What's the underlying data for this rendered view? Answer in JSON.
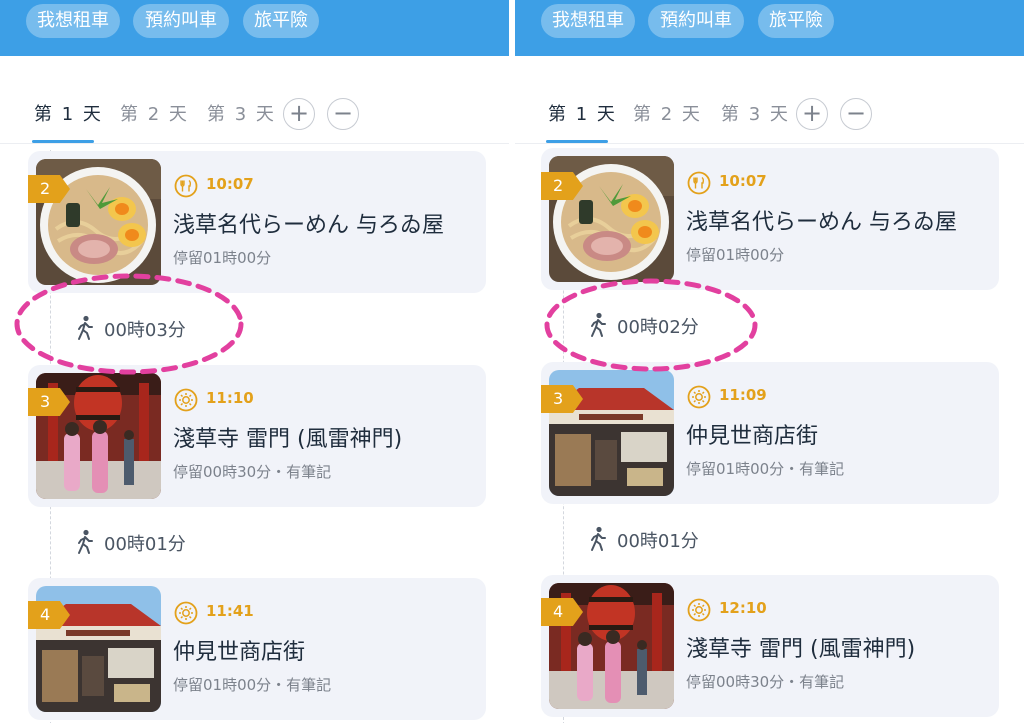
{
  "colors": {
    "header": "#3d9fe6",
    "accent": "#3d9fe6",
    "badge": "#e3a11b",
    "time": "#e3a11b",
    "highlight": "#e2409f",
    "card": "#f1f3f9"
  },
  "panels": [
    {
      "header_buttons": [
        "我想租車",
        "預約叫車",
        "旅平險"
      ],
      "tabs": [
        "第 1 天",
        "第 2 天",
        "第 3 天"
      ],
      "add_icon": "plus-icon",
      "remove_icon": "minus-icon",
      "stops": [
        {
          "number": "2",
          "category_icon": "restaurant-icon",
          "time": "10:07",
          "title": "浅草名代らーめん 与ろゐ屋",
          "stay": "停留01時00分",
          "thumbnail": "ramen-photo"
        },
        {
          "number": "3",
          "category_icon": "sightseeing-icon",
          "time": "11:10",
          "title": "淺草寺 雷門 (風雷神門)",
          "stay": "停留00時30分・有筆記",
          "thumbnail": "kaminarimon-photo"
        },
        {
          "number": "4",
          "category_icon": "sightseeing-icon",
          "time": "11:41",
          "title": "仲見世商店街",
          "stay": "停留01時00分・有筆記",
          "thumbnail": "nakamise-photo"
        }
      ],
      "walks": [
        {
          "icon": "walking-person-icon",
          "duration": "00時03分"
        },
        {
          "icon": "walking-person-icon",
          "duration": "00時01分"
        }
      ]
    },
    {
      "header_buttons": [
        "我想租車",
        "預約叫車",
        "旅平險"
      ],
      "tabs": [
        "第 1 天",
        "第 2 天",
        "第 3 天"
      ],
      "add_icon": "plus-icon",
      "remove_icon": "minus-icon",
      "stops": [
        {
          "number": "2",
          "category_icon": "restaurant-icon",
          "time": "10:07",
          "title": "浅草名代らーめん 与ろゐ屋",
          "stay": "停留01時00分",
          "thumbnail": "ramen-photo"
        },
        {
          "number": "3",
          "category_icon": "sightseeing-icon",
          "time": "11:09",
          "title": "仲見世商店街",
          "stay": "停留01時00分・有筆記",
          "thumbnail": "nakamise-photo"
        },
        {
          "number": "4",
          "category_icon": "sightseeing-icon",
          "time": "12:10",
          "title": "淺草寺 雷門 (風雷神門)",
          "stay": "停留00時30分・有筆記",
          "thumbnail": "kaminarimon-photo"
        }
      ],
      "walks": [
        {
          "icon": "walking-person-icon",
          "duration": "00時02分"
        },
        {
          "icon": "walking-person-icon",
          "duration": "00時01分"
        }
      ]
    }
  ]
}
